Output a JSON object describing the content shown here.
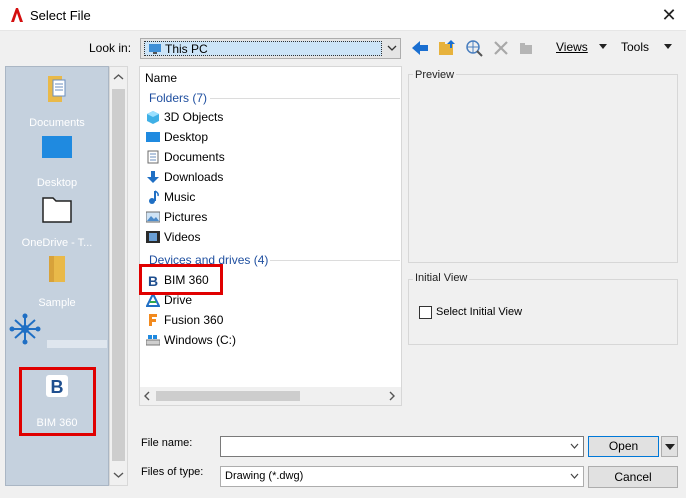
{
  "window": {
    "title": "Select File"
  },
  "toolbar": {
    "look_in_label": "Look in:",
    "look_in_value": "This PC",
    "views_label": "Views",
    "tools_label": "Tools"
  },
  "places": [
    {
      "label": "Documents",
      "icon": "documents-folder-icon"
    },
    {
      "label": "Desktop",
      "icon": "desktop-icon"
    },
    {
      "label": "OneDrive - T...",
      "icon": "folder-outline-icon"
    },
    {
      "label": "Sample",
      "icon": "folder-icon"
    },
    {
      "label": "",
      "icon": "network-hub-icon"
    },
    {
      "label": "BIM 360",
      "icon": "bim360-icon"
    }
  ],
  "filelist": {
    "column_name": "Name",
    "folders_header": "Folders (7)",
    "folders": [
      {
        "label": "3D Objects",
        "icon": "3d-objects-icon"
      },
      {
        "label": "Desktop",
        "icon": "desktop-icon"
      },
      {
        "label": "Documents",
        "icon": "documents-icon"
      },
      {
        "label": "Downloads",
        "icon": "downloads-icon"
      },
      {
        "label": "Music",
        "icon": "music-icon"
      },
      {
        "label": "Pictures",
        "icon": "pictures-icon"
      },
      {
        "label": "Videos",
        "icon": "videos-icon"
      }
    ],
    "drives_header": "Devices and drives (4)",
    "drives": [
      {
        "label": "BIM 360",
        "icon": "bim360-icon"
      },
      {
        "label": "Drive",
        "icon": "drive-icon"
      },
      {
        "label": "Fusion 360",
        "icon": "fusion360-icon"
      },
      {
        "label": "Windows (C:)",
        "icon": "windows-drive-icon"
      }
    ]
  },
  "preview": {
    "label": "Preview"
  },
  "initial_view": {
    "label": "Initial View",
    "checkbox_label": "Select Initial View",
    "checked": false
  },
  "bottom": {
    "file_name_label": "File name:",
    "file_name_value": "",
    "files_of_type_label": "Files of type:",
    "files_of_type_value": "Drawing (*.dwg)",
    "open_label": "Open",
    "cancel_label": "Cancel"
  },
  "colors": {
    "accent": "#0078d7",
    "highlight": "#e00000",
    "places_bg": "#c5d1de"
  }
}
